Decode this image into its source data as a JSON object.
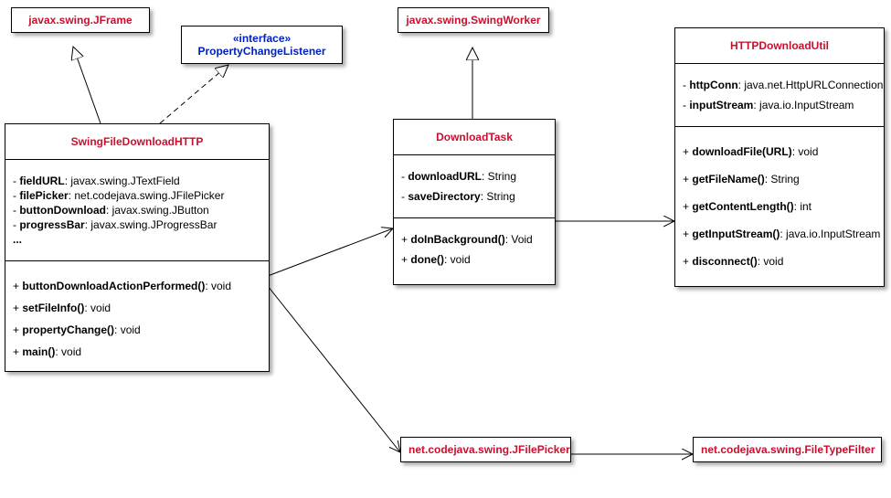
{
  "boxes": {
    "jframe": {
      "title": "javax.swing.JFrame"
    },
    "pcl": {
      "stereotype": "«interface»",
      "name": "PropertyChangeListener"
    },
    "main": {
      "title": "SwingFileDownloadHTTP",
      "attrs": [
        {
          "vis": "-",
          "name": "fieldURL",
          "type": ": javax.swing.JTextField"
        },
        {
          "vis": "-",
          "name": "filePicker",
          "type": ": net.codejava.swing.JFilePicker"
        },
        {
          "vis": "-",
          "name": "buttonDownload",
          "type": ": javax.swing.JButton"
        },
        {
          "vis": "-",
          "name": "progressBar",
          "type": ": javax.swing.JProgressBar"
        },
        {
          "vis": "",
          "name": "...",
          "type": ""
        }
      ],
      "ops": [
        {
          "vis": "+",
          "name": "buttonDownloadActionPerformed()",
          "type": ": void"
        },
        {
          "vis": "+",
          "name": "setFileInfo()",
          "type": ": void"
        },
        {
          "vis": "+",
          "name": "propertyChange()",
          "type": ": void"
        },
        {
          "vis": "+",
          "name": "main()",
          "type": ": void"
        }
      ]
    },
    "swingworker": {
      "title": "javax.swing.SwingWorker"
    },
    "task": {
      "title": "DownloadTask",
      "attrs": [
        {
          "vis": "-",
          "name": "downloadURL",
          "type": ": String"
        },
        {
          "vis": "-",
          "name": "saveDirectory",
          "type": ": String"
        }
      ],
      "ops": [
        {
          "vis": "+",
          "name": "doInBackground()",
          "type": ": Void"
        },
        {
          "vis": "+",
          "name": "done()",
          "type": ": void"
        }
      ]
    },
    "util": {
      "title": "HTTPDownloadUtil",
      "attrs": [
        {
          "vis": "-",
          "name": "httpConn",
          "type": ": java.net.HttpURLConnection"
        },
        {
          "vis": "-",
          "name": "inputStream",
          "type": ": java.io.InputStream"
        }
      ],
      "ops": [
        {
          "vis": "+",
          "name": "downloadFile(URL)",
          "type": ": void"
        },
        {
          "vis": "+",
          "name": "getFileName()",
          "type": ": String"
        },
        {
          "vis": "+",
          "name": "getContentLength()",
          "type": ": int"
        },
        {
          "vis": "+",
          "name": "getInputStream()",
          "type": ": java.io.InputStream"
        },
        {
          "vis": "+",
          "name": "disconnect()",
          "type": ": void"
        }
      ]
    },
    "picker": {
      "title": "net.codejava.swing.JFilePicker"
    },
    "filter": {
      "title": "net.codejava.swing.FileTypeFilter"
    }
  }
}
